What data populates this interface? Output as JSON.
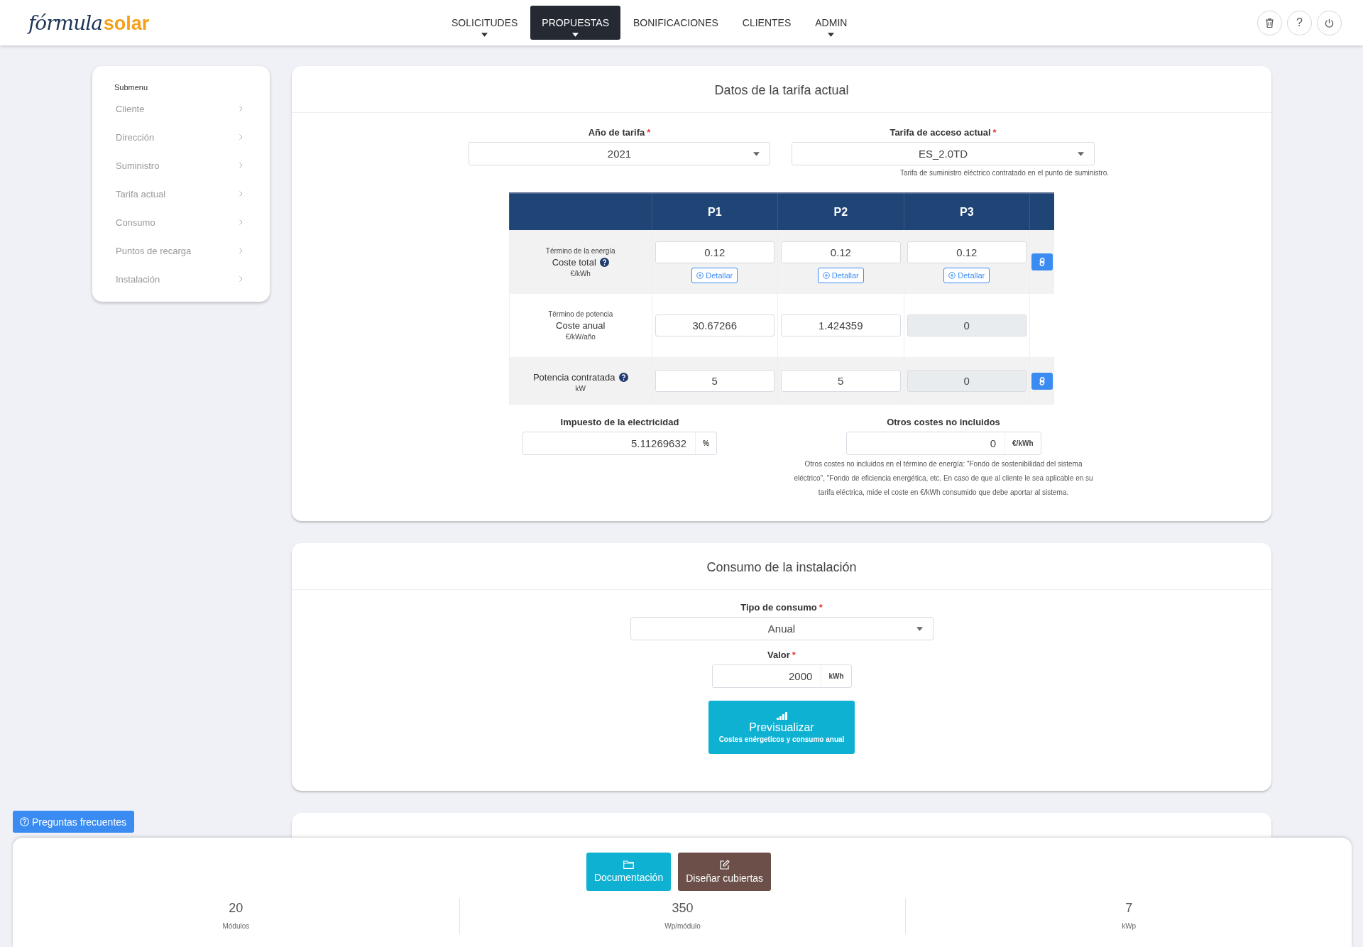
{
  "header": {
    "logo": {
      "script": "fórmula",
      "brand": "solar"
    },
    "nav": [
      {
        "label": "SOLICITUDES",
        "dropdown": true,
        "selected": false
      },
      {
        "label": "PROPUESTAS",
        "dropdown": true,
        "selected": true
      },
      {
        "label": "BONIFICACIONES",
        "dropdown": false,
        "selected": false
      },
      {
        "label": "CLIENTES",
        "dropdown": false,
        "selected": false
      },
      {
        "label": "ADMIN",
        "dropdown": true,
        "selected": false
      }
    ],
    "help_button": "?"
  },
  "submenu": {
    "title": "Submenu",
    "items": [
      "Cliente",
      "Dirección",
      "Suministro",
      "Tarifa actual",
      "Consumo",
      "Puntos de recarga",
      "Instalación"
    ]
  },
  "tariff": {
    "title": "Datos de la tarifa actual",
    "fields": [
      {
        "label": "Año de tarifa",
        "mark": "*",
        "value": "2021"
      },
      {
        "label": "Tarifa de acceso actual",
        "mark": "*",
        "value": "ES_2.0TD",
        "hint": "Tarifa de suministro eléctrico contratado en el punto de suministro."
      }
    ],
    "table": {
      "columns": [
        "P1",
        "P2",
        "P3"
      ],
      "rows": [
        {
          "caption": "Término de la energía",
          "label": "Coste total",
          "help": true,
          "unit": "€/kWh",
          "link": true,
          "values": [
            {
              "value": "0.12",
              "disabled": false,
              "detail": "Detallar"
            },
            {
              "value": "0.12",
              "disabled": false,
              "detail": "Detallar"
            },
            {
              "value": "0.12",
              "disabled": false,
              "detail": "Detallar"
            }
          ]
        },
        {
          "caption": "Término de potencia",
          "label": "Coste anual",
          "help": false,
          "unit": "€/kW/año",
          "link": false,
          "values": [
            {
              "value": "30.67266",
              "disabled": false
            },
            {
              "value": "1.424359",
              "disabled": false
            },
            {
              "value": "0",
              "disabled": true
            }
          ]
        },
        {
          "label": "Potencia contratada",
          "help": true,
          "unit": "kW",
          "link": true,
          "values": [
            {
              "value": "5",
              "disabled": false
            },
            {
              "value": "5",
              "disabled": false
            },
            {
              "value": "0",
              "disabled": true
            }
          ]
        }
      ]
    },
    "tax": {
      "label": "Impuesto de la electricidad",
      "value": "5.11269632",
      "unit": "%"
    },
    "other_costs": {
      "label": "Otros costes no incluidos",
      "value": "0",
      "unit": "€/kWh",
      "hint": "Otros costes no incluidos en el término de energía: \"Fondo de sostenibilidad del sistema eléctrico\", \"Fondo de eficiencia energética, etc. En caso de que al cliente le sea aplicable en su tarifa eléctrica, mide el coste en €/kWh consumido que debe aportar al sistema."
    }
  },
  "consumption": {
    "title": "Consumo de la instalación",
    "type": {
      "label": "Tipo de consumo",
      "mark": "*",
      "value": "Anual"
    },
    "amount": {
      "label": "Valor",
      "mark": "*",
      "value": "2000",
      "unit": "kWh"
    },
    "preview": {
      "label": "Previsualizar",
      "sub": "Costes enérgeticos y consumo anual"
    }
  },
  "faq_button": "Preguntas frecuentes",
  "footer": {
    "buttons": [
      {
        "label": "Documentación",
        "kind": "docs"
      },
      {
        "label": "Diseñar cubiertas",
        "kind": "design"
      }
    ],
    "stats": [
      {
        "value": "20",
        "label": "Módulos"
      },
      {
        "value": "350",
        "label": "Wp/módulo"
      },
      {
        "value": "7",
        "label": "kWp"
      }
    ]
  }
}
